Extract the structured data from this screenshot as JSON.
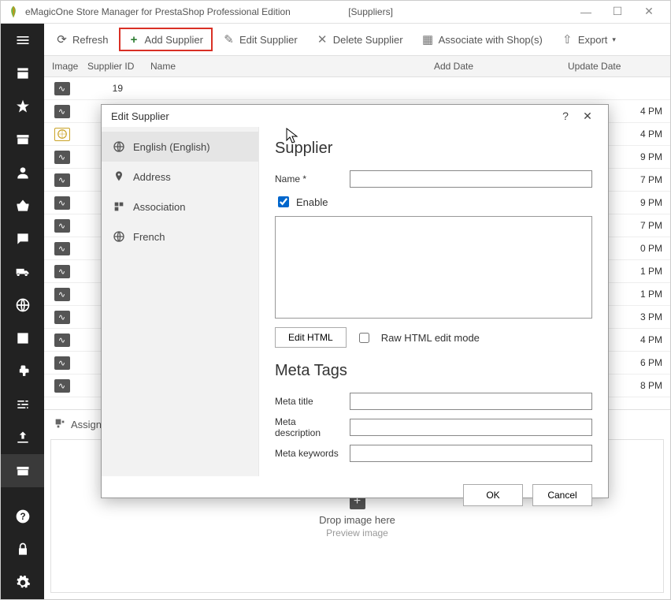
{
  "window": {
    "title": "eMagicOne Store Manager for PrestaShop Professional Edition",
    "context": "[Suppliers]"
  },
  "toolbar": {
    "refresh": "Refresh",
    "add_supplier": "Add Supplier",
    "edit_supplier": "Edit Supplier",
    "delete_supplier": "Delete Supplier",
    "associate": "Associate with Shop(s)",
    "export": "Export"
  },
  "columns": {
    "image": "Image",
    "supplier_id": "Supplier ID",
    "name": "Name",
    "add_date": "Add Date",
    "update_date": "Update Date"
  },
  "rows": [
    {
      "id": "19",
      "upd": ""
    },
    {
      "id": "",
      "upd": "4 PM"
    },
    {
      "id": "",
      "upd": "4 PM",
      "gold": true
    },
    {
      "id": "",
      "upd": "9 PM"
    },
    {
      "id": "",
      "upd": "7 PM"
    },
    {
      "id": "",
      "upd": "9 PM"
    },
    {
      "id": "",
      "upd": "7 PM"
    },
    {
      "id": "",
      "upd": "0 PM"
    },
    {
      "id": "",
      "upd": "1 PM"
    },
    {
      "id": "",
      "upd": "1 PM"
    },
    {
      "id": "",
      "upd": "3 PM"
    },
    {
      "id": "",
      "upd": "4 PM"
    },
    {
      "id": "",
      "upd": "6 PM"
    },
    {
      "id": "",
      "upd": "8 PM"
    }
  ],
  "assign_label": "Assign",
  "drop": {
    "main": "Drop image here",
    "sub": "Preview image"
  },
  "dialog": {
    "title": "Edit Supplier",
    "help": "?",
    "nav": {
      "english": "English (English)",
      "address": "Address",
      "association": "Association",
      "french": "French"
    },
    "section_supplier": "Supplier",
    "name_label": "Name *",
    "enable_label": "Enable",
    "edit_html": "Edit HTML",
    "raw_mode": "Raw HTML edit mode",
    "section_meta": "Meta Tags",
    "meta_title": "Meta title",
    "meta_desc": "Meta description",
    "meta_keywords": "Meta keywords",
    "ok": "OK",
    "cancel": "Cancel"
  }
}
